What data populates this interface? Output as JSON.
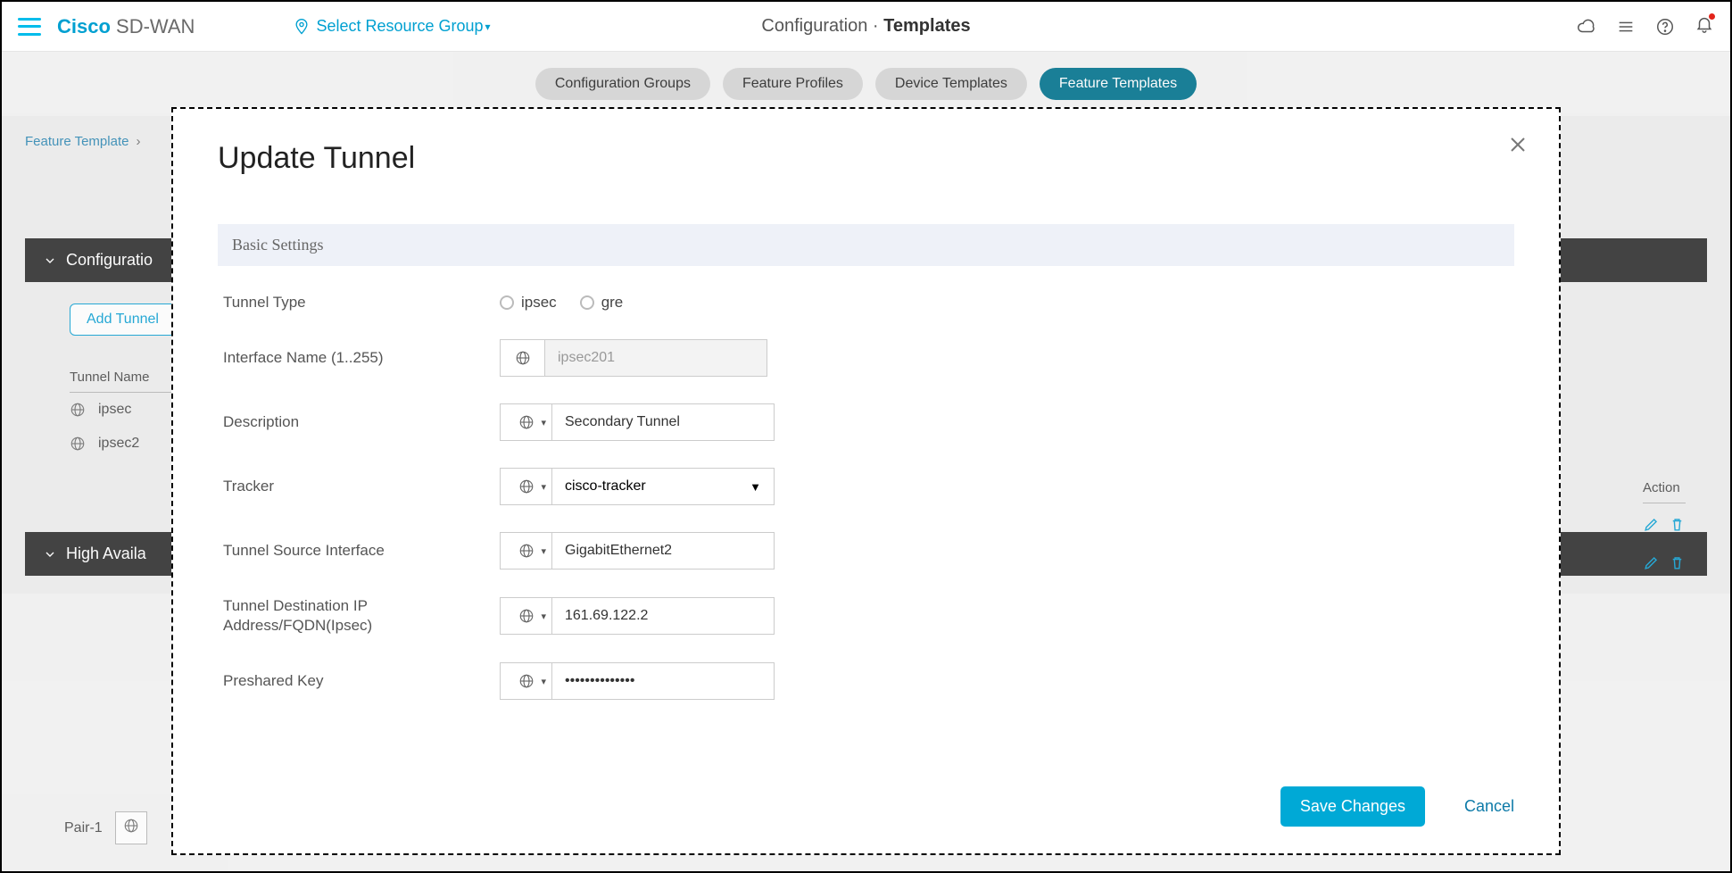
{
  "header": {
    "brand_cisco": "Cisco",
    "brand_product": "SD-WAN",
    "resource_group": "Select Resource Group",
    "title_light": "Configuration",
    "title_sep": "·",
    "title_bold": "Templates"
  },
  "tabs": {
    "t1": "Configuration Groups",
    "t2": "Feature Profiles",
    "t3": "Device Templates",
    "t4": "Feature Templates"
  },
  "crumb": {
    "item1": "Feature Template"
  },
  "bg": {
    "section1": "Configuratio",
    "section2": "High Availa",
    "add_tunnel": "Add Tunnel",
    "col_tunnel_name": "Tunnel Name",
    "col_action": "Action",
    "row1": "ipsec",
    "row2": "ipsec2",
    "pair": "Pair-1"
  },
  "modal": {
    "title": "Update Tunnel",
    "section_basic": "Basic Settings",
    "labels": {
      "tunnel_type": "Tunnel Type",
      "interface_name": "Interface Name (1..255)",
      "description": "Description",
      "tracker": "Tracker",
      "source_if": "Tunnel Source Interface",
      "dest_ip": "Tunnel Destination IP Address/FQDN(Ipsec)",
      "psk": "Preshared Key"
    },
    "radios": {
      "ipsec": "ipsec",
      "gre": "gre"
    },
    "values": {
      "interface_name": "ipsec201",
      "description": "Secondary Tunnel",
      "tracker": "cisco-tracker",
      "source_if": "GigabitEthernet2",
      "dest_ip": "161.69.122.2",
      "psk": "••••••••••••••"
    },
    "buttons": {
      "save": "Save Changes",
      "cancel": "Cancel"
    }
  }
}
